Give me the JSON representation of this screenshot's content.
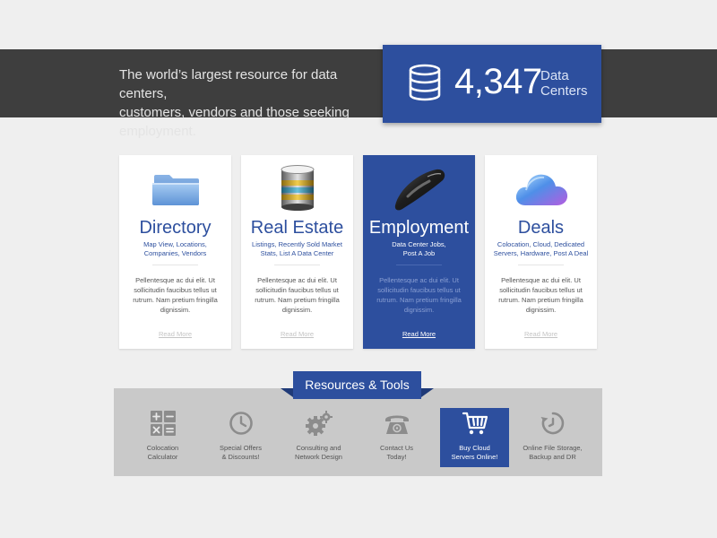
{
  "hero": {
    "tagline_line1": "The world’s largest resource for data centers,",
    "tagline_line2": "customers, vendors and those seeking employment.",
    "stat_number": "4,347",
    "stat_label_line1": "Data",
    "stat_label_line2": "Centers",
    "stat_icon": "database-icon"
  },
  "cards": [
    {
      "title": "Directory",
      "sub_line1": "Map View, Locations,",
      "sub_line2": "Companies, Vendors",
      "body_line1": "Pellentesque ac dui elit. Ut",
      "body_line2": "sollicitudin faucibus tellus ut",
      "body_line3": "rutrum. Nam pretium fringilla",
      "body_line4": "dignissim.",
      "link": "Read More",
      "icon": "folder-icon"
    },
    {
      "title": "Real Estate",
      "sub_line1": "Listings, Recently Sold Market",
      "sub_line2": "Stats, List A Data Center",
      "body_line1": "Pellentesque ac dui elit. Ut",
      "body_line2": "sollicitudin faucibus tellus ut",
      "body_line3": "rutrum. Nam pretium fringilla",
      "body_line4": "dignissim.",
      "link": "Read More",
      "icon": "database-stack-icon"
    },
    {
      "title": "Employment",
      "sub_line1": "Data Center Jobs,",
      "sub_line2": "Post A Job",
      "body_line1": "Pellentesque ac dui elit. Ut",
      "body_line2": "sollicitudin faucibus tellus ut",
      "body_line3": "rutrum. Nam pretium fringilla",
      "body_line4": "dignissim.",
      "link": "Read More",
      "icon": "mouse-icon"
    },
    {
      "title": "Deals",
      "sub_line1": "Colocation, Cloud, Dedicated",
      "sub_line2": "Servers, Hardware, Post A Deal",
      "body_line1": "Pellentesque ac dui elit. Ut",
      "body_line2": "sollicitudin faucibus tellus ut",
      "body_line3": "rutrum. Nam pretium fringilla",
      "body_line4": "dignissim.",
      "link": "Read More",
      "icon": "cloud-icon"
    }
  ],
  "resources": {
    "title": "Resources & Tools",
    "tools": [
      {
        "line1": "Colocation",
        "line2": "Calculator",
        "icon": "calculator-icon"
      },
      {
        "line1": "Special Offers",
        "line2": "& Discounts!",
        "icon": "clock-icon"
      },
      {
        "line1": "Consulting and",
        "line2": "Network Design",
        "icon": "gears-icon"
      },
      {
        "line1": "Contact Us",
        "line2": "Today!",
        "icon": "telephone-icon"
      },
      {
        "line1": "Buy Cloud",
        "line2": "Servers Online!",
        "icon": "shopping-cart-icon"
      },
      {
        "line1": "Online File Storage,",
        "line2": "Backup and DR",
        "icon": "backup-icon"
      }
    ]
  },
  "colors": {
    "brand_blue": "#2d4f9e",
    "hero_bar": "#3e3e3e",
    "page_background": "#efefef",
    "tools_panel": "#c9c9c9"
  }
}
